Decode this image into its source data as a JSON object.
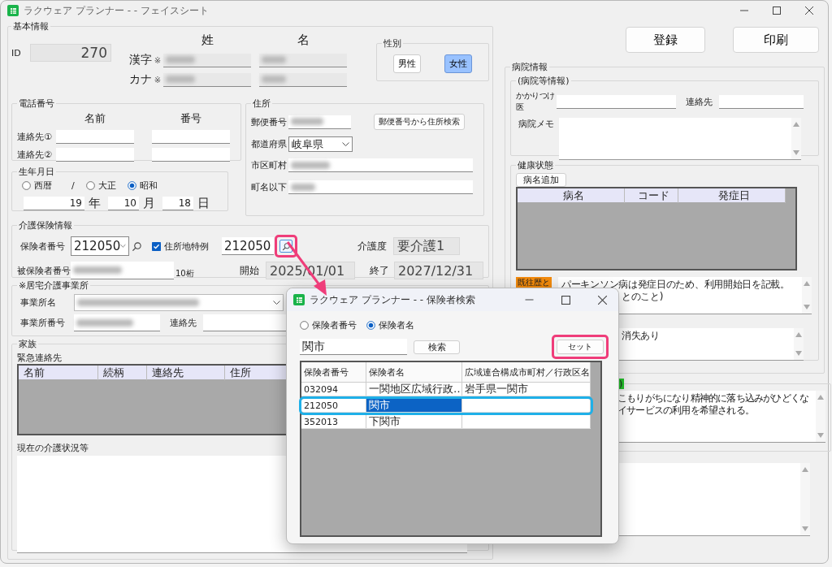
{
  "window": {
    "title": "ラクウェア プランナー - - フェイスシート"
  },
  "basic": {
    "label": "基本情報",
    "id_label": "ID",
    "id_value": "270",
    "col_headers": [
      "姓",
      "名"
    ],
    "name_rows": [
      {
        "label": "漢字",
        "mark": "※"
      },
      {
        "label": "カナ",
        "mark": "※"
      }
    ]
  },
  "gender": {
    "label": "性別",
    "options": [
      {
        "label": "男性",
        "selected": false
      },
      {
        "label": "女性",
        "selected": true
      }
    ]
  },
  "phone": {
    "label": "電話番号",
    "headers": [
      "名前",
      "番号"
    ],
    "rows": [
      {
        "label": "連絡先①"
      },
      {
        "label": "連絡先②"
      }
    ]
  },
  "address": {
    "label": "住所",
    "postal_label": "郵便番号",
    "postal_button": "郵便番号から住所検索",
    "prefecture_label": "都道府県",
    "prefecture": "岐阜県",
    "city_label": "市区町村",
    "street_label": "町名以下"
  },
  "birth": {
    "label": "生年月日",
    "eras": [
      {
        "label": "西暦",
        "selected": false
      },
      {
        "label": "大正",
        "selected": false
      },
      {
        "label": "昭和",
        "selected": true
      }
    ],
    "separator": "/",
    "parts": [
      {
        "value": "19",
        "unit": "年"
      },
      {
        "value": "10",
        "unit": "月"
      },
      {
        "value": "18",
        "unit": "日"
      }
    ]
  },
  "insurance": {
    "label": "介護保険情報",
    "insurer_label": "保険者番号",
    "insurer": "212050",
    "special": {
      "label": "住所地特例",
      "checked": true
    },
    "special_value": "212050",
    "care_label": "介護度",
    "care_level": "要介護1",
    "insured_label": "被保険者番号",
    "digits": "10桁",
    "start_label": "開始",
    "start": "2025/01/01",
    "end_label": "終了",
    "end": "2027/12/31"
  },
  "office": {
    "label": "※居宅介護事業所",
    "name_label": "事業所名",
    "number_label": "事業所番号",
    "contact_label": "連絡先"
  },
  "family": {
    "label": "家族",
    "contacts_label": "緊急連絡先",
    "columns": [
      "名前",
      "続柄",
      "連絡先",
      "住所"
    ],
    "status_label": "現在の介護状況等"
  },
  "actions": [
    "登録",
    "印刷"
  ],
  "hospital": {
    "label": "病院情報",
    "sub_label": "(病院等情報)",
    "doctor_label": "かかりつけ医",
    "contact_label": "連絡先",
    "memo_label": "病院メモ"
  },
  "health": {
    "label": "健康状態",
    "add_button": "病名追加",
    "columns": [
      "病名",
      "コード",
      "発症日"
    ],
    "history_tag": "既往歴と",
    "history_lines": [
      "パーキンソン病は発症日のため、利用開始日を記載。",
      "とのこと)"
    ],
    "note_text": "消失あり"
  },
  "wish": {
    "tag": ")",
    "lines": [
      "こもりがちになり精神的に落ち込みがひどくな",
      "イサービスの利用を希望される。"
    ]
  },
  "dialog": {
    "title": "ラクウェア プランナー - - 保険者検索",
    "modes": [
      {
        "label": "保険者番号",
        "selected": false
      },
      {
        "label": "保険者名",
        "selected": true
      }
    ],
    "query": "関市",
    "search_button": "検索",
    "set_button": "セット",
    "columns": [
      "保険者番号",
      "保険者名",
      "広域連合構成市町村／行政区名"
    ],
    "rows": [
      {
        "cells": [
          "032094",
          "一関地区広域行政…",
          "岩手県一関市"
        ],
        "selected": false
      },
      {
        "cells": [
          "212050",
          "関市"
        ],
        "selected": true
      },
      {
        "cells": [
          "352013",
          "下関市"
        ],
        "selected": false
      }
    ]
  }
}
